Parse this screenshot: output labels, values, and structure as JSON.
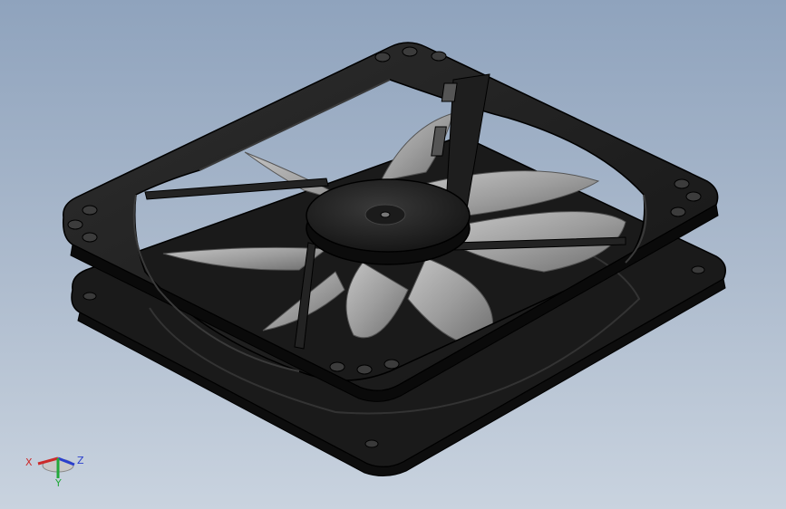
{
  "triad": {
    "x_label": "X",
    "y_label": "Y",
    "z_label": "Z",
    "x_color": "#cc2a2a",
    "y_color": "#22a83a",
    "z_color": "#2a3fcc"
  },
  "model": {
    "icon": "cooling-fan-3d-model",
    "frame_color": "#1e1e1e",
    "blade_color": "#9a9a9a",
    "blade_count": 7
  }
}
